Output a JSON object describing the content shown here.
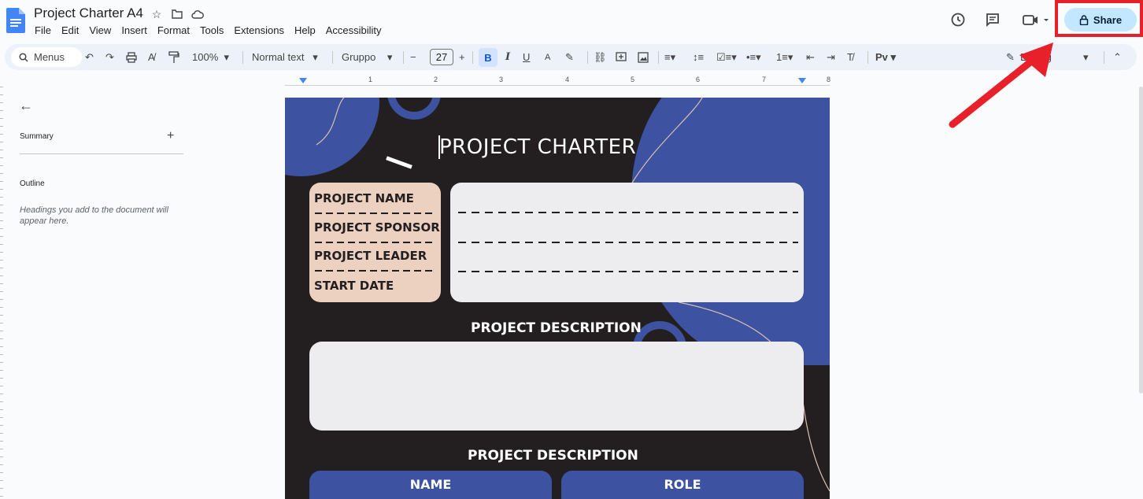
{
  "app": {
    "doc_title": "Project Charter A4",
    "menu": [
      "File",
      "Edit",
      "View",
      "Insert",
      "Format",
      "Tools",
      "Extensions",
      "Help",
      "Accessibility"
    ],
    "share_label": "Share"
  },
  "toolbar": {
    "menus_label": "Menus",
    "zoom": "100%",
    "style": "Normal text",
    "font": "Gruppo",
    "font_size": "27",
    "bold": "B",
    "italic": "I",
    "underline": "U",
    "text_color": "A",
    "editing_label": "Editing"
  },
  "ruler": {
    "numbers": [
      "1",
      "2",
      "3",
      "4",
      "5",
      "6",
      "7",
      "8"
    ]
  },
  "sidebar": {
    "summary_label": "Summary",
    "outline_label": "Outline",
    "outline_hint": "Headings you add to the document will appear here."
  },
  "document": {
    "title": "PROJECT CHARTER",
    "fields": [
      "PROJECT NAME",
      "PROJECT SPONSOR",
      "PROJECT LEADER",
      "START DATE"
    ],
    "section1": "PROJECT DESCRIPTION",
    "section2": "PROJECT DESCRIPTION",
    "table_headers": [
      "NAME",
      "ROLE"
    ]
  },
  "colors": {
    "page_bg": "#231f20",
    "accent_blue": "#3d52a0",
    "label_bg": "#ecd0c0",
    "box_bg": "#ededf0",
    "share_bg": "#c2e7ff",
    "highlight_red": "#e8202a"
  }
}
